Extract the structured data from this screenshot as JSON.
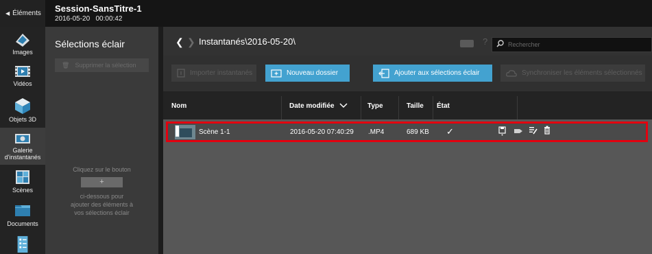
{
  "topbar": {
    "back_label": "Éléments",
    "session_title": "Session-SansTitre-1",
    "session_date": "2016-05-20",
    "session_time": "00:00:42"
  },
  "nav": {
    "items": [
      {
        "label": "Images",
        "icon": "images-icon"
      },
      {
        "label": "Vidéos",
        "icon": "videos-icon"
      },
      {
        "label": "Objets 3D",
        "icon": "3d-objects-icon"
      },
      {
        "label": "Galerie d'instantanés",
        "icon": "snapshot-gallery-icon",
        "active": true
      },
      {
        "label": "Scènes",
        "icon": "scenes-icon"
      },
      {
        "label": "Documents",
        "icon": "documents-icon"
      },
      {
        "label": "",
        "icon": "checklist-icon"
      }
    ]
  },
  "flash": {
    "title": "Sélections éclair",
    "delete_label": "Supprimer la sélection",
    "hint_top": "Cliquez sur le bouton",
    "plus_label": "+",
    "hint_bottom_1": "ci-dessous pour",
    "hint_bottom_2": "ajouter des éléments à",
    "hint_bottom_3": "vos sélections éclair"
  },
  "main": {
    "path": "Instantanés\\2016-05-20\\",
    "search_placeholder": "Rechercher"
  },
  "actions": {
    "import_label": "Importer instantanés",
    "new_folder_label": "Nouveau dossier",
    "add_flash_label": "Ajouter aux sélections éclair",
    "sync_label": "Synchroniser les éléments sélectionnés"
  },
  "table": {
    "headers": {
      "name": "Nom",
      "date": "Date modifiée",
      "type": "Type",
      "size": "Taille",
      "state": "État"
    },
    "rows": [
      {
        "name": "Scène 1-1",
        "date": "2016-05-20 07:40:29",
        "type": ".MP4",
        "size": "689 KB",
        "state": "✓"
      }
    ]
  },
  "colors": {
    "accent": "#43a2d0",
    "highlight": "#e3000f"
  }
}
